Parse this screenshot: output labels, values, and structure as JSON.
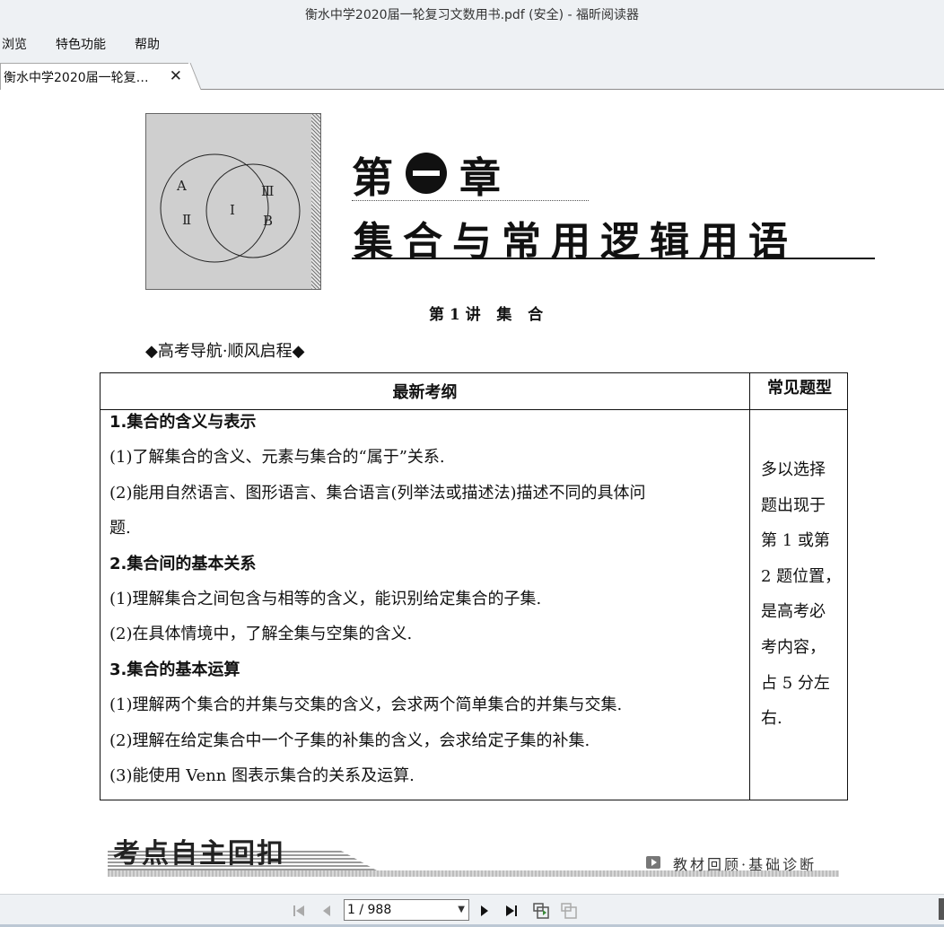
{
  "window": {
    "title": "衡水中学2020届一轮复习文数用书.pdf (安全) - 福昕阅读器"
  },
  "menu": {
    "items": [
      "浏览",
      "特色功能",
      "帮助"
    ]
  },
  "tab": {
    "label": "衡水中学2020届一轮复…",
    "close": "✕"
  },
  "figure": {
    "labels": {
      "a": "A",
      "ii": "Ⅱ",
      "i": "Ⅰ",
      "iii": "Ⅲ",
      "b": "B"
    }
  },
  "chapter": {
    "prefix": "第",
    "suffix": "章",
    "title": "集合与常用逻辑用语"
  },
  "lecture": {
    "title": "第 1 讲   集   合"
  },
  "guide": {
    "title": "◆高考导航·顺风启程◆"
  },
  "table": {
    "header_left": "最新考纲",
    "header_right": "常见题型",
    "lines": [
      {
        "text": "1.集合的含义与表示",
        "bold": true
      },
      {
        "text": "(1)了解集合的含义、元素与集合的“属于”关系.",
        "bold": false
      },
      {
        "text": "(2)能用自然语言、图形语言、集合语言(列举法或描述法)描述不同的具体问",
        "bold": false
      },
      {
        "text": "题.",
        "bold": false
      },
      {
        "text": "2.集合间的基本关系",
        "bold": true
      },
      {
        "text": "(1)理解集合之间包含与相等的含义，能识别给定集合的子集.",
        "bold": false
      },
      {
        "text": "(2)在具体情境中，了解全集与空集的含义.",
        "bold": false
      },
      {
        "text": "3.集合的基本运算",
        "bold": true
      },
      {
        "text": "(1)理解两个集合的并集与交集的含义，会求两个简单集合的并集与交集.",
        "bold": false
      },
      {
        "text": "(2)理解在给定集合中一个子集的补集的含义，会求给定子集的补集.",
        "bold": false
      },
      {
        "text": "(3)能使用 Venn 图表示集合的关系及运算.",
        "bold": false
      }
    ],
    "side_lines": [
      "多以选择",
      "题出现于",
      "第 1 或第",
      "2 题位置，",
      "是高考必",
      "考内容，",
      "占 5 分左",
      "右."
    ]
  },
  "banner": {
    "title": "考点自主回扣",
    "subtitle": "教材回顾·基础诊断"
  },
  "statusbar": {
    "page_indicator": "1 / 988"
  },
  "colors": {
    "chrome": "#eef1f4",
    "text": "#111111",
    "figure_bg": "#cfcfcf"
  }
}
